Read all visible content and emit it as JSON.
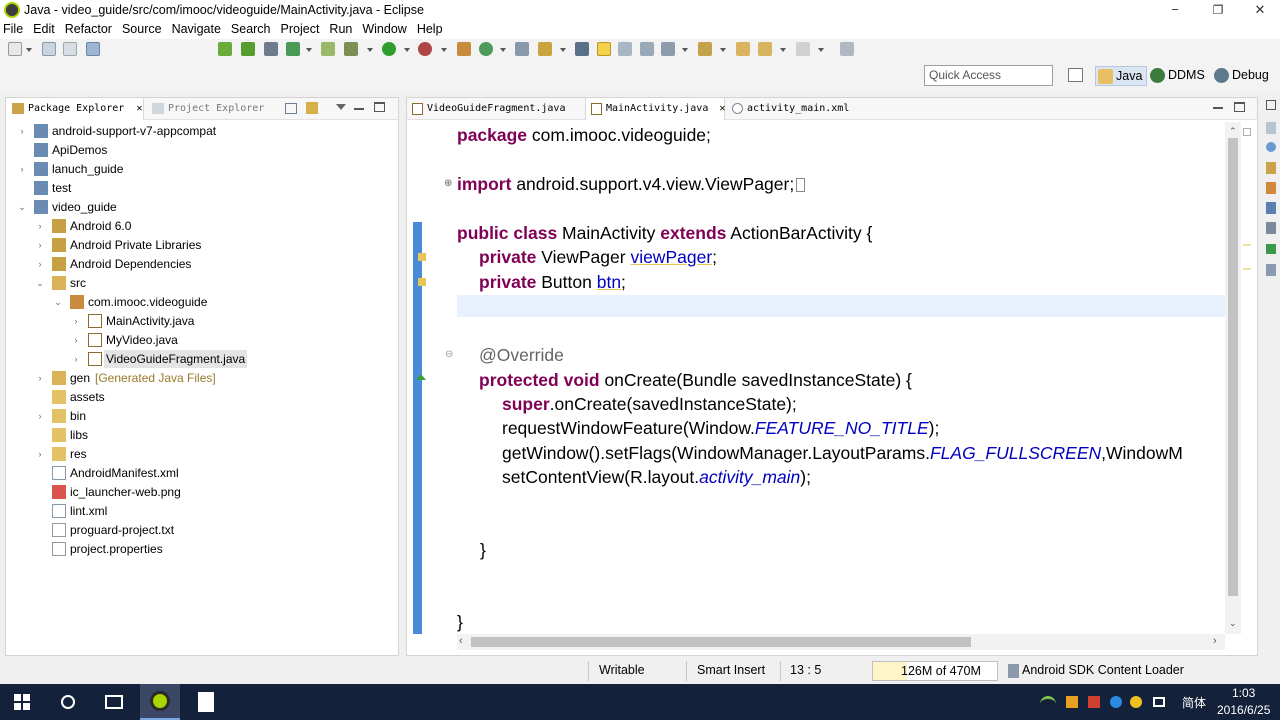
{
  "window": {
    "title": "Java - video_guide/src/com/imooc/videoguide/MainActivity.java - Eclipse",
    "minimize": "−",
    "maximize": "❐",
    "close": "✕"
  },
  "menu": [
    "File",
    "Edit",
    "Refactor",
    "Source",
    "Navigate",
    "Search",
    "Project",
    "Run",
    "Window",
    "Help"
  ],
  "quick_access": {
    "placeholder": "Quick Access"
  },
  "perspectives": [
    {
      "label": "Java",
      "icon": "java-perspective-icon"
    },
    {
      "label": "DDMS",
      "icon": "ddms-icon"
    },
    {
      "label": "Debug",
      "icon": "debug-icon"
    }
  ],
  "left_tabs": [
    {
      "label": "Package Explorer",
      "close": "✕"
    },
    {
      "label": "Project Explorer"
    }
  ],
  "tree": [
    {
      "label": "android-support-v7-appcompat",
      "icon": "project-icon",
      "toggle": "›"
    },
    {
      "label": "ApiDemos",
      "icon": "project-icon",
      "toggle": ""
    },
    {
      "label": "lanuch_guide",
      "icon": "project-icon",
      "toggle": "›"
    },
    {
      "label": "test",
      "icon": "project-icon",
      "toggle": ""
    },
    {
      "label": "video_guide",
      "icon": "project-icon",
      "toggle": "⌄"
    },
    {
      "label": "Android 6.0",
      "icon": "library-icon",
      "toggle": "›"
    },
    {
      "label": "Android Private Libraries",
      "icon": "library-icon",
      "toggle": "›"
    },
    {
      "label": "Android Dependencies",
      "icon": "library-icon",
      "toggle": "›"
    },
    {
      "label": "src",
      "icon": "source-folder-icon",
      "toggle": "⌄"
    },
    {
      "label": "com.imooc.videoguide",
      "icon": "package-icon",
      "toggle": "⌄"
    },
    {
      "label": "MainActivity.java",
      "icon": "java-file-icon",
      "toggle": "›"
    },
    {
      "label": "MyVideo.java",
      "icon": "java-file-icon",
      "toggle": "›"
    },
    {
      "label": "VideoGuideFragment.java",
      "icon": "java-file-icon",
      "toggle": "›"
    },
    {
      "label": "gen",
      "extra": "[Generated Java Files]",
      "icon": "source-folder-icon",
      "toggle": "›"
    },
    {
      "label": "assets",
      "icon": "folder-icon",
      "toggle": ""
    },
    {
      "label": "bin",
      "icon": "folder-icon",
      "toggle": "›"
    },
    {
      "label": "libs",
      "icon": "folder-icon",
      "toggle": ""
    },
    {
      "label": "res",
      "icon": "folder-icon",
      "toggle": "›"
    },
    {
      "label": "AndroidManifest.xml",
      "icon": "xml-file-icon",
      "toggle": ""
    },
    {
      "label": "ic_launcher-web.png",
      "icon": "image-file-icon",
      "toggle": ""
    },
    {
      "label": "lint.xml",
      "icon": "xml-file-icon",
      "toggle": ""
    },
    {
      "label": "proguard-project.txt",
      "icon": "text-file-icon",
      "toggle": ""
    },
    {
      "label": "project.properties",
      "icon": "text-file-icon",
      "toggle": ""
    }
  ],
  "editor_tabs": [
    {
      "label": "VideoGuideFragment.java"
    },
    {
      "label": "MainActivity.java",
      "close": "✕"
    },
    {
      "label": "activity_main.xml"
    }
  ],
  "code": {
    "l1": {
      "kw": "package",
      "rest": " com.imooc.videoguide;"
    },
    "l2": {
      "kw": "import",
      "rest": " android.support.v4.view.ViewPager;"
    },
    "l3": {
      "kw1": "public class",
      "mid": " MainActivity ",
      "kw2": "extends",
      "rest": " ActionBarActivity {"
    },
    "l4": {
      "kw": "private",
      "mid": " ViewPager ",
      "fld": "viewPager",
      "rest": ";"
    },
    "l5": {
      "kw": "private",
      "mid": " Button ",
      "fld": "btn",
      "rest": ";"
    },
    "l6": {
      "ann": "@Override"
    },
    "l7": {
      "kw": "protected void",
      "rest": " onCreate(Bundle savedInstanceState) {"
    },
    "l8": {
      "kw": "super",
      "rest": ".onCreate(savedInstanceState);"
    },
    "l9": {
      "pre": "requestWindowFeature(Window.",
      "sfld": "FEATURE_NO_TITLE",
      "rest": ");"
    },
    "l10": {
      "pre": "getWindow().setFlags(WindowManager.LayoutParams.",
      "sfld": "FLAG_FULLSCREEN",
      "rest": ",WindowM"
    },
    "l11": {
      "pre": "setContentView(R.layout.",
      "sfld": "activity_main",
      "rest": ");"
    },
    "l12": "}",
    "l13": "}"
  },
  "status": {
    "writable": "Writable",
    "insert_mode": "Smart Insert",
    "position": "13 : 5",
    "memory": "126M of 470M",
    "loader": "Android SDK Content Loader"
  },
  "taskbar": {
    "ime": "简体",
    "time": "1:03",
    "date": "2016/6/25"
  }
}
